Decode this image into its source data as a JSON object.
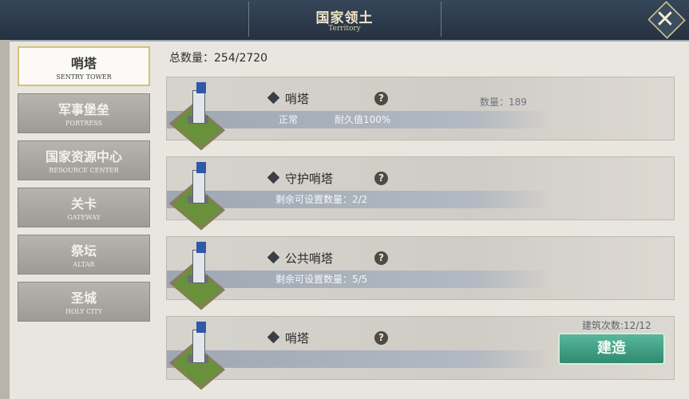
{
  "header": {
    "title": "国家领土",
    "subtitle": "Territory",
    "close_icon": "close-icon"
  },
  "sidebar": {
    "items": [
      {
        "label": "哨塔",
        "sub": "SENTRY TOWER",
        "active": true
      },
      {
        "label": "军事堡垒",
        "sub": "FORTRESS",
        "active": false
      },
      {
        "label": "国家资源中心",
        "sub": "RESOURCE CENTER",
        "active": false
      },
      {
        "label": "关卡",
        "sub": "GATEWAY",
        "active": false
      },
      {
        "label": "祭坛",
        "sub": "ALTAR",
        "active": false
      },
      {
        "label": "圣城",
        "sub": "HOLY CITY",
        "active": false
      }
    ]
  },
  "summary": {
    "total_label": "总数量：254/2720"
  },
  "cards": [
    {
      "name": "哨塔",
      "count": "数量：189",
      "status": "正常",
      "durability": "耐久值100%"
    },
    {
      "name": "守护哨塔",
      "remaining": "剩余可设置数量：2/2"
    },
    {
      "name": "公共哨塔",
      "remaining": "剩余可设置数量：5/5"
    },
    {
      "name": "哨塔",
      "build_count": "建筑次数:12/12",
      "build_label": "建造"
    }
  ],
  "colors": {
    "accent": "#2f8a70",
    "header_bg": "#2b3a4a",
    "stripe": "#a5adb8"
  }
}
